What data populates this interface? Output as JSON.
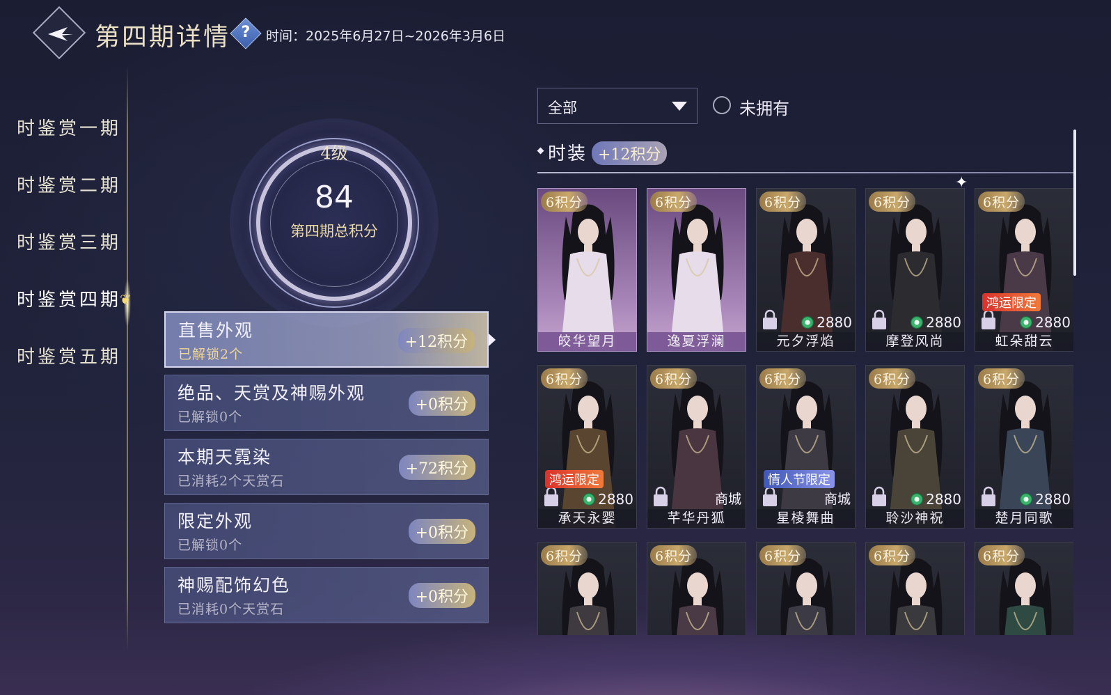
{
  "header": {
    "title": "第四期详情",
    "time": "时间：2025年6月27日~2026年3月6日",
    "help_glyph": "?"
  },
  "nav": {
    "items": [
      {
        "label": "时鉴赏一期"
      },
      {
        "label": "时鉴赏二期"
      },
      {
        "label": "时鉴赏三期"
      },
      {
        "label": "时鉴赏四期",
        "active": true
      },
      {
        "label": "时鉴赏五期"
      }
    ]
  },
  "score": {
    "level": "4级",
    "value": "84",
    "label": "第四期总积分"
  },
  "categories": [
    {
      "title": "直售外观",
      "sub": "已解锁2个",
      "points": "+12积分",
      "active": true
    },
    {
      "title": "绝品、天赏及神赐外观",
      "sub": "已解锁0个",
      "points": "+0积分"
    },
    {
      "title": "本期天霓染",
      "sub": "已消耗2个天赏石",
      "points": "+72积分"
    },
    {
      "title": "限定外观",
      "sub": "已解锁0个",
      "points": "+0积分"
    },
    {
      "title": "神赐配饰幻色",
      "sub": "已消耗0个天赏石",
      "points": "+0积分"
    }
  ],
  "filter": {
    "selected": "全部",
    "unowned_label": "未拥有"
  },
  "section": {
    "title": "时装",
    "points": "+12积分"
  },
  "cards": [
    {
      "points": "6积分",
      "name": "皎华望月",
      "owned": true
    },
    {
      "points": "6积分",
      "name": "逸夏浮澜",
      "owned": true
    },
    {
      "points": "6积分",
      "name": "元夕浮焰",
      "price": "2880"
    },
    {
      "points": "6积分",
      "name": "摩登风尚",
      "price": "2880"
    },
    {
      "points": "6积分",
      "name": "虹朵甜云",
      "price": "2880",
      "tag": "鸿运限定",
      "tag_color": "red"
    },
    {
      "points": "6积分",
      "name": "承天永婴",
      "price": "2880",
      "tag": "鸿运限定",
      "tag_color": "red"
    },
    {
      "points": "6积分",
      "name": "芊华丹狐",
      "shop": "商城"
    },
    {
      "points": "6积分",
      "name": "星棱舞曲",
      "shop": "商城",
      "tag": "情人节限定",
      "tag_color": "blue"
    },
    {
      "points": "6积分",
      "name": "聆沙神祝",
      "price": "2880"
    },
    {
      "points": "6积分",
      "name": "楚月同歌",
      "price": "2880"
    },
    {
      "points": "6积分",
      "name": ""
    },
    {
      "points": "6积分",
      "name": ""
    },
    {
      "points": "6积分",
      "name": ""
    },
    {
      "points": "6积分",
      "name": ""
    },
    {
      "points": "6积分",
      "name": ""
    }
  ],
  "colors": {
    "accent_gold": "#e9d8a8",
    "owned_card": "#a785b8",
    "jade_currency": "#3bb36d"
  }
}
